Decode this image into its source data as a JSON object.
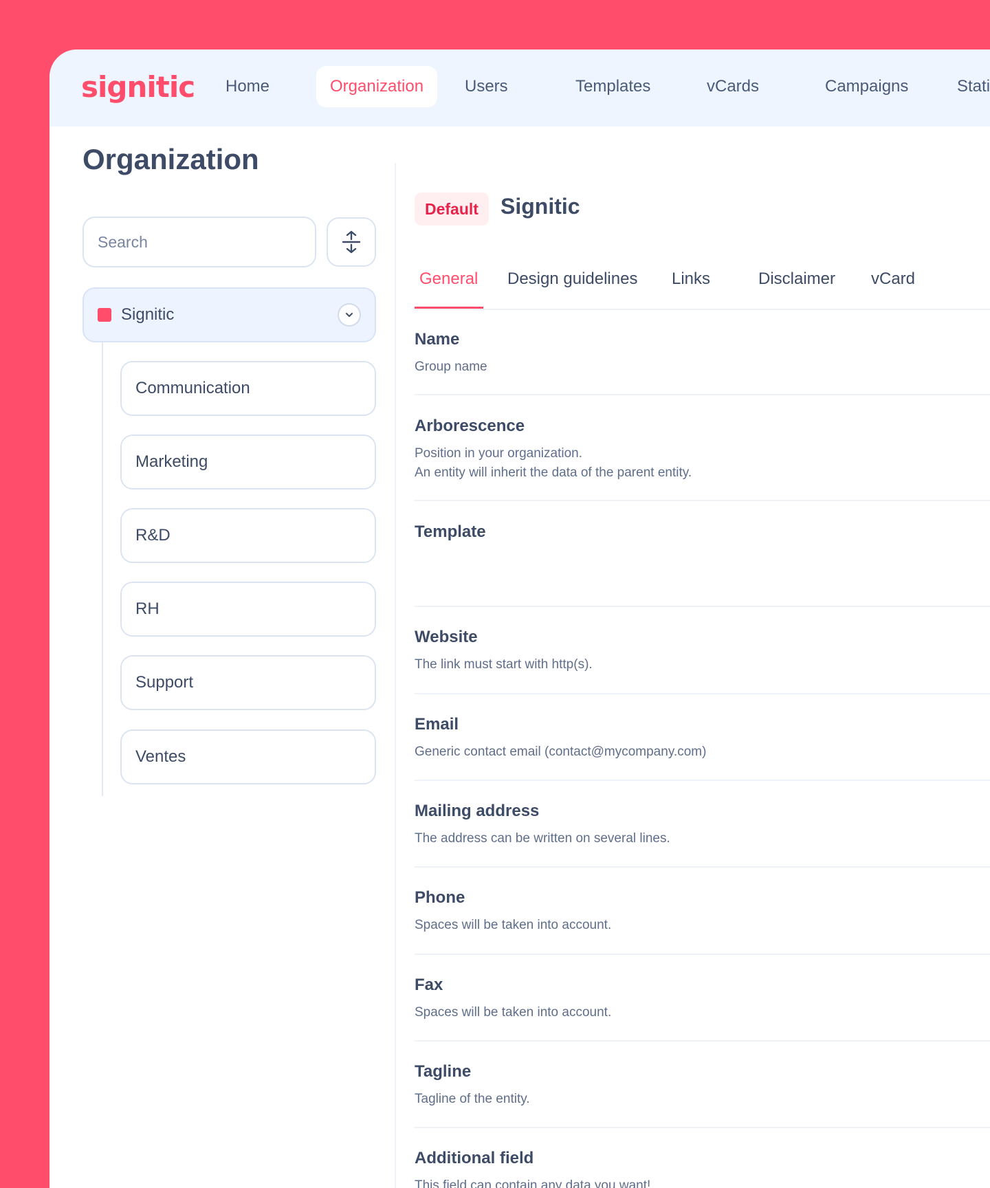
{
  "app": {
    "logo": "signitic"
  },
  "nav": {
    "items": [
      {
        "label": "Home"
      },
      {
        "label": "Organization"
      },
      {
        "label": "Users"
      },
      {
        "label": "Templates"
      },
      {
        "label": "vCards"
      },
      {
        "label": "Campaigns"
      },
      {
        "label": "Statisti"
      }
    ]
  },
  "sidebar": {
    "title": "Organization",
    "search_placeholder": "Search",
    "root": {
      "label": "Signitic"
    },
    "children": [
      {
        "label": "Communication"
      },
      {
        "label": "Marketing"
      },
      {
        "label": "R&D"
      },
      {
        "label": "RH"
      },
      {
        "label": "Support"
      },
      {
        "label": "Ventes"
      }
    ]
  },
  "entity": {
    "badge": "Default",
    "name": "Signitic"
  },
  "tabs": [
    {
      "label": "General"
    },
    {
      "label": "Design guidelines"
    },
    {
      "label": "Links"
    },
    {
      "label": "Disclaimer"
    },
    {
      "label": "vCard"
    }
  ],
  "fields": [
    {
      "label": "Name",
      "desc": "Group name"
    },
    {
      "label": "Arborescence",
      "desc": "Position in your organization.",
      "desc2": "An entity will inherit the data of the parent entity."
    },
    {
      "label": "Template",
      "desc": ""
    },
    {
      "label": "Website",
      "desc": "The link must start with http(s)."
    },
    {
      "label": "Email",
      "desc": "Generic contact email (contact@mycompany.com)"
    },
    {
      "label": "Mailing address",
      "desc": "The address can be written on several lines."
    },
    {
      "label": "Phone",
      "desc": "Spaces will be taken into account."
    },
    {
      "label": "Fax",
      "desc": "Spaces will be taken into account."
    },
    {
      "label": "Tagline",
      "desc": "Tagline of the entity."
    },
    {
      "label": "Additional field",
      "desc": "This field can contain any data you want!"
    }
  ],
  "colors": {
    "brand": "#FF4D6B",
    "nav_bg": "#EEF5FF",
    "text": "#3D4B66"
  },
  "icons": {
    "sort": "expand-collapse-icon",
    "chevron": "chevron-down-icon",
    "entity": "square-icon"
  }
}
